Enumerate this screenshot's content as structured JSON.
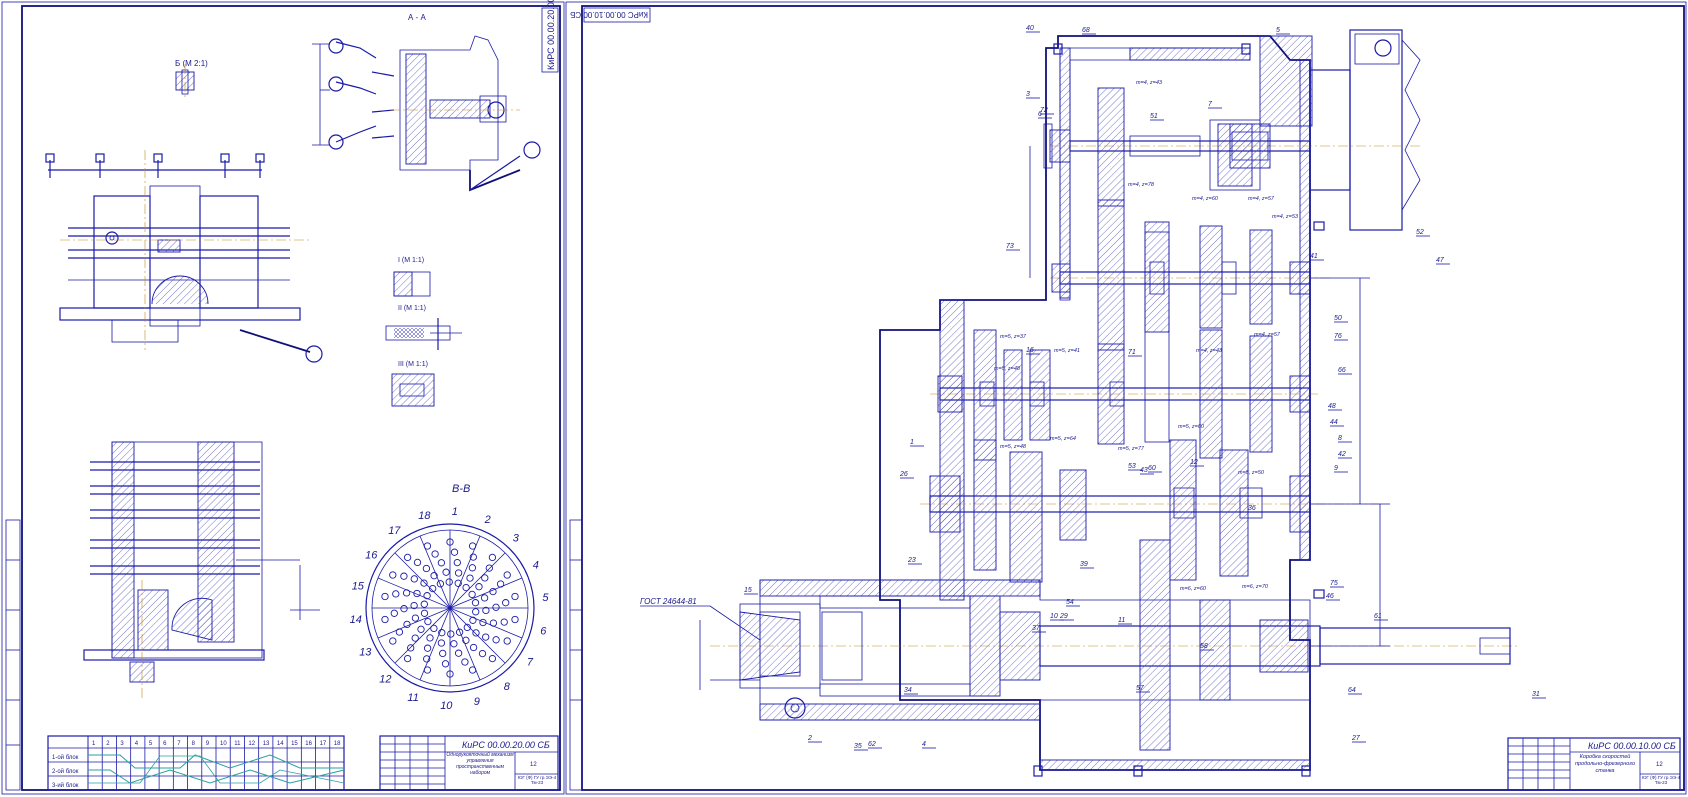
{
  "left_sheet": {
    "stamp_code": "КиРС 00.00.20.00 СБ",
    "section_aa": "А - А",
    "section_bb": "В-В",
    "view_g": "Б (М 2:1)",
    "view_1": "I (М 1:1)",
    "view_2": "II (М 1:1)",
    "view_3": "III (М 1:1)",
    "dial_numbers": [
      "1",
      "2",
      "3",
      "4",
      "5",
      "6",
      "7",
      "8",
      "9",
      "10",
      "11",
      "12",
      "13",
      "14",
      "15",
      "16",
      "17",
      "18"
    ],
    "table_rows": [
      "1-ой блок",
      "2-ой блок",
      "3-ий блок"
    ],
    "title_block": {
      "code": "КиРС 00.00.20.00 СБ",
      "name": "Однорукояточный механизм управления пространственным набором",
      "sheet": "12",
      "org": "ЮГ (Ф) ГУ гр.ЭЭ-4 Тм-23"
    }
  },
  "right_sheet": {
    "stamp_code": "КиРС 00.00.10.00 СБ",
    "gost": "ГОСТ 24644-81",
    "title_block": {
      "code": "КиРС 00.00.10.00 СБ",
      "name": "Коробка скоростей продольно-фрезерного станка",
      "sheet": "12",
      "org": "ЮГ (Ф) ГУ гр.ЭЭ-4 Тм-23"
    },
    "callouts": [
      "40",
      "68",
      "5",
      "6",
      "3",
      "72",
      "51",
      "7",
      "73",
      "16",
      "52",
      "47",
      "41",
      "50",
      "76",
      "66",
      "8",
      "42",
      "9",
      "48",
      "44",
      "71",
      "12",
      "53",
      "36",
      "43",
      "60",
      "10",
      "29",
      "11",
      "39",
      "54",
      "75",
      "46",
      "61",
      "15",
      "31",
      "27",
      "58",
      "64",
      "57",
      "34",
      "37",
      "35",
      "2",
      "62",
      "4",
      "23",
      "26",
      "1"
    ],
    "gear_labels": [
      "m=4, z=43",
      "m=4, z=78",
      "m=4, z=60",
      "m=4, z=57",
      "m=4, z=53",
      "m=5, z=37",
      "m=5, z=48",
      "m=5, z=41",
      "m=5, z=48",
      "m=5, z=64",
      "m=5, z=77",
      "m=5, z=60",
      "m=5, z=50",
      "m=6, z=60",
      "m=6, z=70",
      "m=4, z=43",
      "m=4, z=57"
    ]
  }
}
